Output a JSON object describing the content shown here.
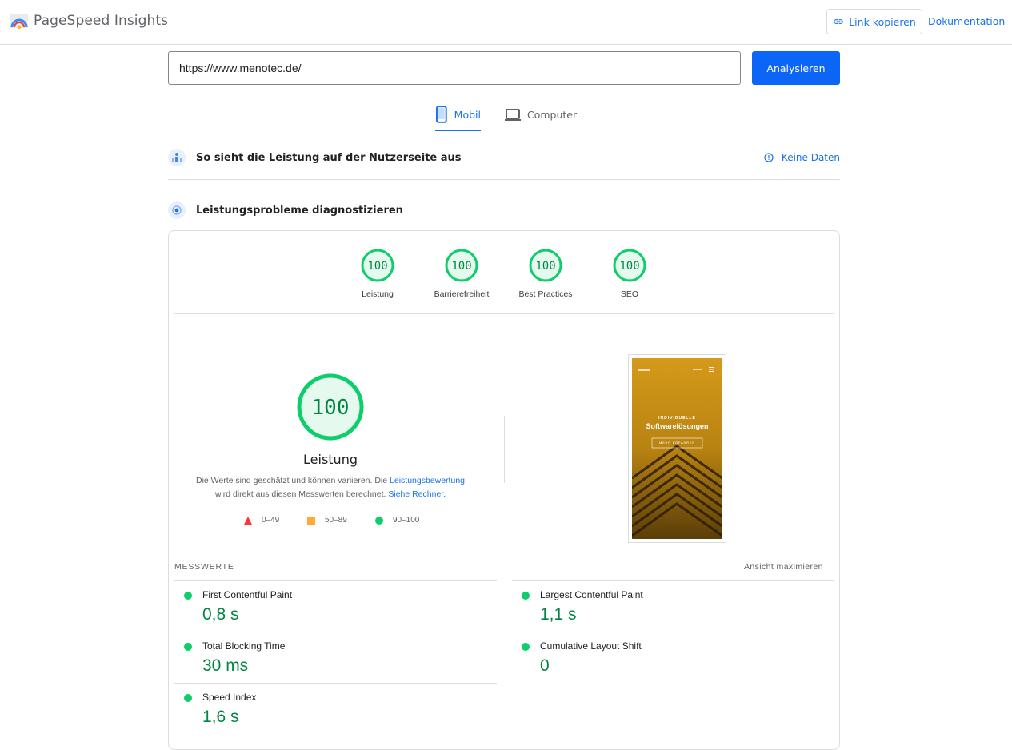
{
  "header": {
    "app_name": "PageSpeed Insights",
    "copy_link": "Link kopieren",
    "docs": "Dokumentation"
  },
  "search": {
    "url": "https://www.menotec.de/",
    "analyze": "Analysieren"
  },
  "tabs": [
    {
      "label": "Mobil",
      "active": true
    },
    {
      "label": "Computer",
      "active": false
    }
  ],
  "sections": {
    "field": {
      "title": "So sieht die Leistung auf der Nutzerseite aus",
      "status": "Keine Daten"
    },
    "lab": {
      "title": "Leistungsprobleme diagnostizieren"
    }
  },
  "scores": [
    {
      "label": "Leistung",
      "score": 100
    },
    {
      "label": "Barrierefreiheit",
      "score": 100
    },
    {
      "label": "Best Practices",
      "score": 100
    },
    {
      "label": "SEO",
      "score": 100
    }
  ],
  "summary": {
    "score": 100,
    "label": "Leistung",
    "desc_part1": "Die Werte sind geschätzt und können variieren. Die ",
    "desc_link1": "Leistungsbewertung",
    "desc_part2": "wird direkt aus diesen Messwerten berechnet. ",
    "desc_link2": "Siehe Rechner."
  },
  "legend": [
    {
      "range": "0–49",
      "color": "#ff3333"
    },
    {
      "range": "50–89",
      "color": "#ffaa33"
    },
    {
      "range": "90–100",
      "color": "#0cce6b"
    }
  ],
  "preview": {
    "tagline": "INDIVIDUELLE",
    "headline": "Softwarelösungen",
    "cta": "MEHR ERFAHREN"
  },
  "metrics_header": "MESSWERTE",
  "expand_label": "Ansicht maximieren",
  "metrics": [
    {
      "label": "First Contentful Paint",
      "value": "0,8 s"
    },
    {
      "label": "Largest Contentful Paint",
      "value": "1,1 s"
    },
    {
      "label": "Total Blocking Time",
      "value": "30 ms"
    },
    {
      "label": "Cumulative Layout Shift",
      "value": "0"
    },
    {
      "label": "Speed Index",
      "value": "1,6 s"
    }
  ],
  "colors": {
    "accent": "#1a73e8",
    "good": "#0cce6b",
    "good_text": "#018642"
  }
}
